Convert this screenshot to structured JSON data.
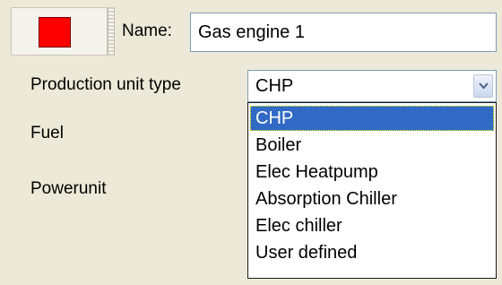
{
  "header": {
    "color_hex": "#ff0000",
    "name_label": "Name:",
    "name_value": "Gas engine 1"
  },
  "form": {
    "production_unit_type_label": "Production unit type",
    "fuel_label": "Fuel",
    "powerunit_label": "Powerunit",
    "selected_type": "CHP"
  },
  "dropdown": {
    "icon": "chevron-down-icon",
    "options": [
      {
        "label": "CHP",
        "highlighted": true
      },
      {
        "label": "Boiler",
        "highlighted": false
      },
      {
        "label": "Elec Heatpump",
        "highlighted": false
      },
      {
        "label": "Absorption Chiller",
        "highlighted": false
      },
      {
        "label": "Elec chiller",
        "highlighted": false
      },
      {
        "label": "User defined",
        "highlighted": false
      }
    ]
  },
  "colors": {
    "selection": "#316ac5",
    "panel_bg": "#ece9d8",
    "input_border": "#7f9db9"
  }
}
